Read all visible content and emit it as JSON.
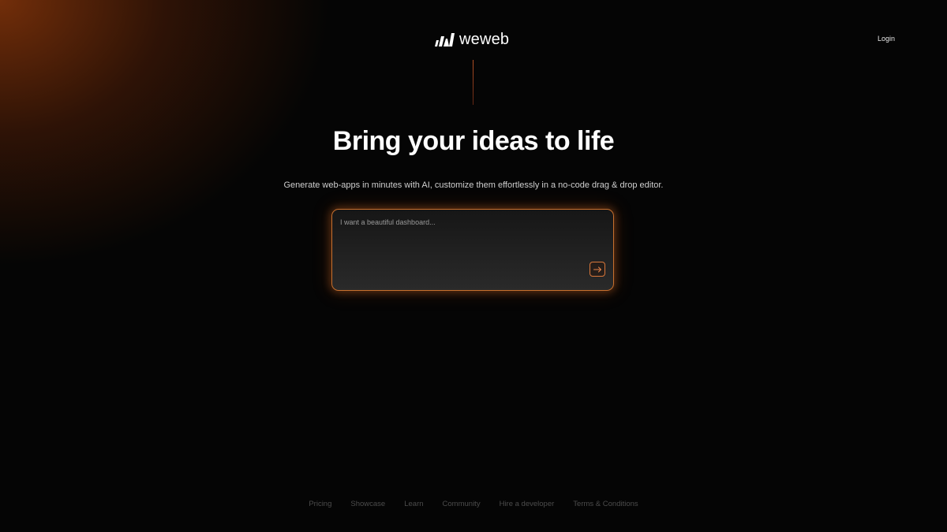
{
  "header": {
    "logo_text": "weweb",
    "login_label": "Login"
  },
  "hero": {
    "title": "Bring your ideas to life",
    "subtitle": "Generate web-apps in minutes with AI, customize them effortlessly in a no-code drag & drop editor."
  },
  "prompt": {
    "placeholder": "I want a beautiful dashboard...",
    "value": "",
    "send_icon": "arrow-right-icon"
  },
  "footer": {
    "links": [
      "Pricing",
      "Showcase",
      "Learn",
      "Community",
      "Hire a developer",
      "Terms & Conditions"
    ]
  },
  "colors": {
    "background": "#050505",
    "accent": "#d9773a",
    "glow": "#78300a",
    "text_primary": "#ffffff",
    "text_secondary": "#cfcfcf",
    "footer_text": "#4c4c4c"
  }
}
